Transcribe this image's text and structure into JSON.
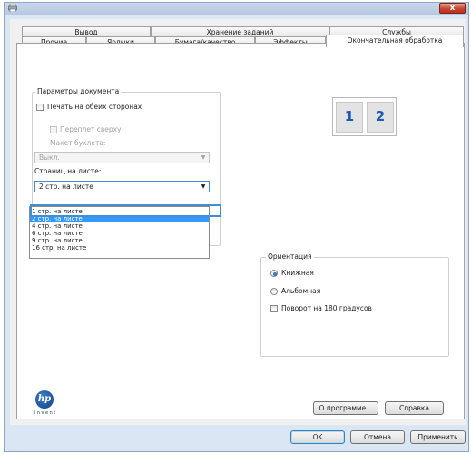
{
  "window": {
    "close_label": "x"
  },
  "tabs_row_back": [
    {
      "label": "Вывод"
    },
    {
      "label": "Хранение заданий"
    },
    {
      "label": "Службы"
    }
  ],
  "tabs_row_front": [
    {
      "label": "Прочие"
    },
    {
      "label": "Ярлыки"
    },
    {
      "label": "Бумага/качество"
    },
    {
      "label": "Эффекты"
    },
    {
      "label": "Окончательная обработка",
      "active": true
    }
  ],
  "document_options": {
    "group_title": "Параметры документа",
    "print_both_sides": {
      "label": "Печать на обеих сторонах",
      "checked": false
    },
    "flip_pages_up": {
      "label": "Переплет сверху",
      "checked": false,
      "disabled": true
    },
    "booklet_layout": {
      "label": "Макет буклета:",
      "value": "Выкл.",
      "disabled": true
    },
    "pages_per_sheet": {
      "label": "Страниц на листе:",
      "value": "2 стр. на листе",
      "options": [
        "1 стр. на листе",
        "2 стр. на листе",
        "4 стр. на листе",
        "6 стр. на листе",
        "9 стр. на листе",
        "16 стр. на листе"
      ],
      "selected_index": 1
    }
  },
  "preview": {
    "page1": "1",
    "page2": "2"
  },
  "orientation": {
    "group_title": "Ориентация",
    "portrait": {
      "label": "Книжная",
      "selected": true
    },
    "landscape": {
      "label": "Альбомная",
      "selected": false
    },
    "rotate_180": {
      "label": "Поворот на 180 градусов",
      "checked": false
    }
  },
  "logo": {
    "mark": "hp",
    "tagline": "invent"
  },
  "buttons": {
    "about": "О программе...",
    "help": "Справка",
    "ok": "OK",
    "cancel": "Отмена",
    "apply": "Применить"
  },
  "colors": {
    "accent": "#3d8fd8",
    "selection": "#3399ff",
    "close": "#c7452e"
  }
}
